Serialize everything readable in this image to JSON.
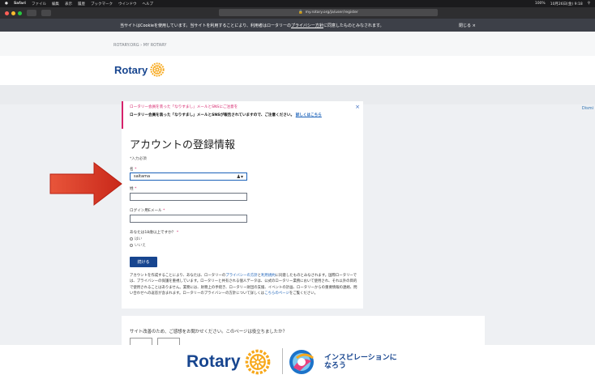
{
  "menubar": {
    "items": [
      "Safari",
      "ファイル",
      "編集",
      "表示",
      "履歴",
      "ブックマーク",
      "ウインドウ",
      "ヘルプ"
    ],
    "status_right": "100%",
    "datetime": "10月26日(金) 9:18"
  },
  "browser": {
    "url": "my.rotary.org/ja/user/register"
  },
  "cookie_banner": {
    "text_prefix": "当サイトはCookieを使用しています。当サイトを利用することにより、利用者はロータリーの",
    "link_text": "プライバシー方針",
    "text_suffix": "に同意したものとみなされます。",
    "close_label": "閉じる ×"
  },
  "breadcrumb": "ROTARY.ORG › MY ROTARY",
  "logo": {
    "text": "Rotary"
  },
  "dismiss": "Dismi",
  "alert": {
    "heading": "ロータリー会員を装った「なりすまし」メールとSNSにご注意を",
    "body": "ロータリー会員を装った「なりすまし」メールとSNSが報告されていますので、ご注意ください。",
    "link": "詳しくはこちら"
  },
  "form": {
    "title": "アカウントの登録情報",
    "required_note": "*入力必須",
    "first_name_label": "名",
    "first_name_value": "saitama",
    "last_name_label": "姓",
    "email_label": "ログイン用Eメール",
    "age_question": "あなたは18歳以上ですか？",
    "yes": "はい",
    "no": "いいえ",
    "continue": "続ける",
    "legal_1": "アカウントを作成することにより、あなたは、ロータリーの",
    "legal_link_1": "プライバシーの方針",
    "legal_and": "と",
    "legal_link_2": "利用規約",
    "legal_2": "に同意したものとみなされます。国際ロータリーでは、プライバシーの保護を重視しています。ロータリーと共有される個人データは、公式のロータリー業務において使用され、それ以外の目的で使用されることはありません。業務には、財務上の手続き、ロータリー財団の支援、イベントの計画、ロータリーからの重要情報の連絡、問い合わせへの返答が含まれます。ロータリーのプライバシーの方針について詳しくは",
    "legal_link_3": "こちらのページ",
    "legal_3": "をご覧ください。"
  },
  "survey": {
    "question": "サイト改善のため、ご感想をお聞かせください。このページは役立ちましたか？"
  },
  "footer": {
    "logo_text": "Rotary",
    "theme_line1": "インスピレーションに",
    "theme_line2": "なろう"
  },
  "colors": {
    "rotary_blue": "#17458f",
    "rotary_gold": "#f7a81b",
    "alert_pink": "#d6226b",
    "arrow_red": "#d93a25"
  }
}
